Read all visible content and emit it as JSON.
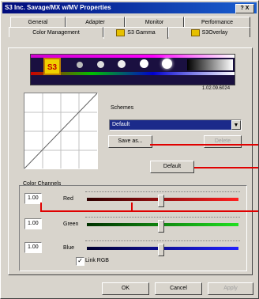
{
  "window": {
    "title": "S3 Inc. Savage/MX w/MV Properties",
    "title_buttons": "? X"
  },
  "tabs": {
    "row1": [
      "General",
      "Adapter",
      "Monitor",
      "Performance"
    ],
    "row2": [
      "Color Management",
      "S3 Gamma",
      "S3Overlay"
    ]
  },
  "banner": {
    "logo": "S3",
    "version": "1.02.09.6024"
  },
  "schemes": {
    "label": "Schemes",
    "selected": "Default",
    "save_as": "Save as...",
    "delete": "Delete"
  },
  "default_button": "Default",
  "color_channels": {
    "label": "Color Channels",
    "red": {
      "label": "Red",
      "value": "1.00",
      "level": 0.5
    },
    "green": {
      "label": "Green",
      "value": "1.00",
      "level": 0.5
    },
    "blue": {
      "label": "Blue",
      "value": "1.00",
      "level": 0.5
    },
    "link_rgb": "Link RGB",
    "link_rgb_checked": true
  },
  "footer": {
    "ok": "OK",
    "cancel": "Cancel",
    "apply": "Apply"
  }
}
